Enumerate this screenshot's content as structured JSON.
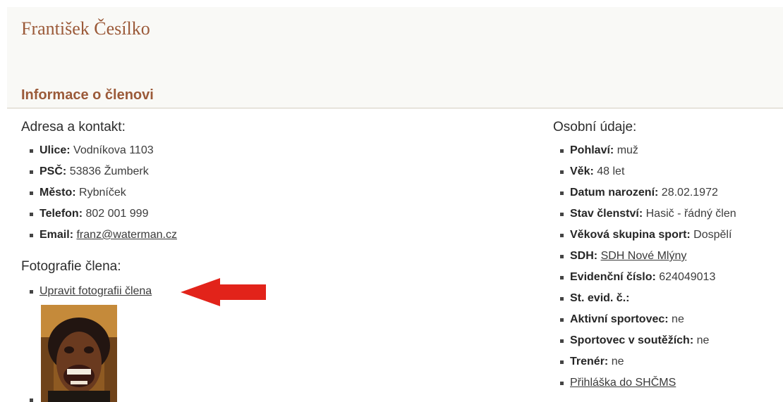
{
  "member": {
    "name": "František Česílko"
  },
  "section": {
    "title": "Informace o členovi"
  },
  "address": {
    "heading": "Adresa a kontakt:",
    "items": [
      {
        "label": "Ulice:",
        "value": "Vodníkova 1103"
      },
      {
        "label": "PSČ:",
        "value": "53836 Žumberk"
      },
      {
        "label": "Město:",
        "value": "Rybníček"
      },
      {
        "label": "Telefon:",
        "value": "802 001 999"
      },
      {
        "label": "Email:",
        "value": "franz@waterman.cz"
      }
    ]
  },
  "photo": {
    "heading": "Fotografie člena:",
    "edit_link": "Upravit fotografii člena"
  },
  "personal": {
    "heading": "Osobní údaje:",
    "items": [
      {
        "label": "Pohlaví:",
        "value": "muž"
      },
      {
        "label": "Věk:",
        "value": "48 let"
      },
      {
        "label": "Datum narození:",
        "value": "28.02.1972"
      },
      {
        "label": "Stav členství:",
        "value": "Hasič - řádný člen"
      },
      {
        "label": "Věková skupina sport:",
        "value": "Dospělí"
      },
      {
        "label": "SDH:",
        "value": "SDH Nové Mlýny"
      },
      {
        "label": "Evidenční číslo:",
        "value": "624049013"
      },
      {
        "label": "St. evid. č.:",
        "value": ""
      },
      {
        "label": "Aktivní sportovec:",
        "value": "ne"
      },
      {
        "label": "Sportovec v soutěžích:",
        "value": "ne"
      },
      {
        "label": "Trenér:",
        "value": "ne"
      }
    ],
    "application_link": "Přihláška do SHČMS"
  },
  "annotation": {
    "arrow_color": "#e2231a",
    "icon": "red-arrow-left"
  },
  "colors": {
    "heading_brown": "#9b5a39",
    "header_background": "#f9f9f6"
  }
}
